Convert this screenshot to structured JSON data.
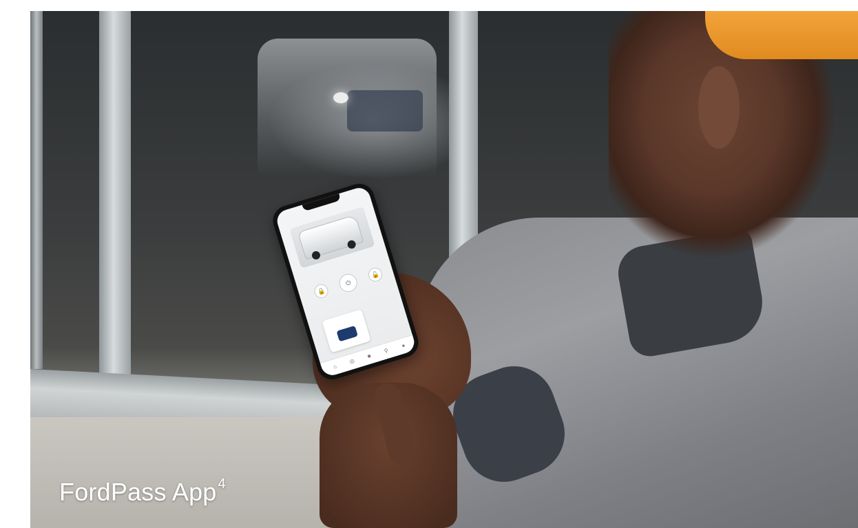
{
  "caption": {
    "title": "FordPass App",
    "footnote": "4"
  },
  "phone_screen": {
    "icons": [
      "lock-icon",
      "power-icon",
      "unlock-icon",
      "home-icon",
      "location-icon",
      "user-icon"
    ]
  },
  "colors": {
    "cap_orange": "#e08b1f",
    "jacket_gray": "#8a8c90",
    "caption_text": "#ffffff"
  }
}
